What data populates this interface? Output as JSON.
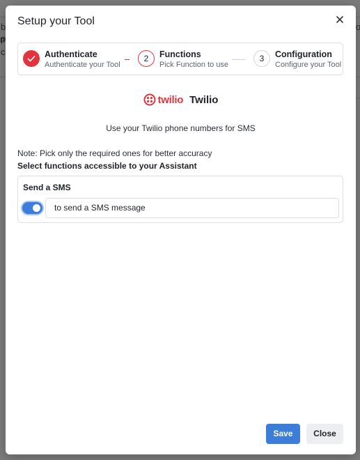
{
  "background": {
    "fragments": [
      "b",
      "p",
      "m",
      "c",
      "o"
    ]
  },
  "modal": {
    "title": "Setup your Tool",
    "close_icon": "close-icon"
  },
  "stepper": {
    "steps": [
      {
        "number": "1",
        "title": "Authenticate",
        "subtitle": "Authenticate your Tool",
        "state": "done"
      },
      {
        "number": "2",
        "title": "Functions",
        "subtitle": "Pick Function to use",
        "state": "active"
      },
      {
        "number": "3",
        "title": "Configuration",
        "subtitle": "Configure your Tool",
        "state": "todo"
      }
    ]
  },
  "tool": {
    "logo_text": "twilio",
    "name": "Twilio",
    "description": "Use your Twilio phone numbers for SMS"
  },
  "functions": {
    "note": "Note: Pick only the required ones for better accuracy",
    "label": "Select functions accessible to your Assistant",
    "items": [
      {
        "title": "Send a SMS",
        "enabled": true,
        "description": "to send a SMS message"
      }
    ]
  },
  "footer": {
    "save_label": "Save",
    "close_label": "Close"
  },
  "colors": {
    "accent": "#3b7dd8",
    "brand": "#e1343f"
  }
}
